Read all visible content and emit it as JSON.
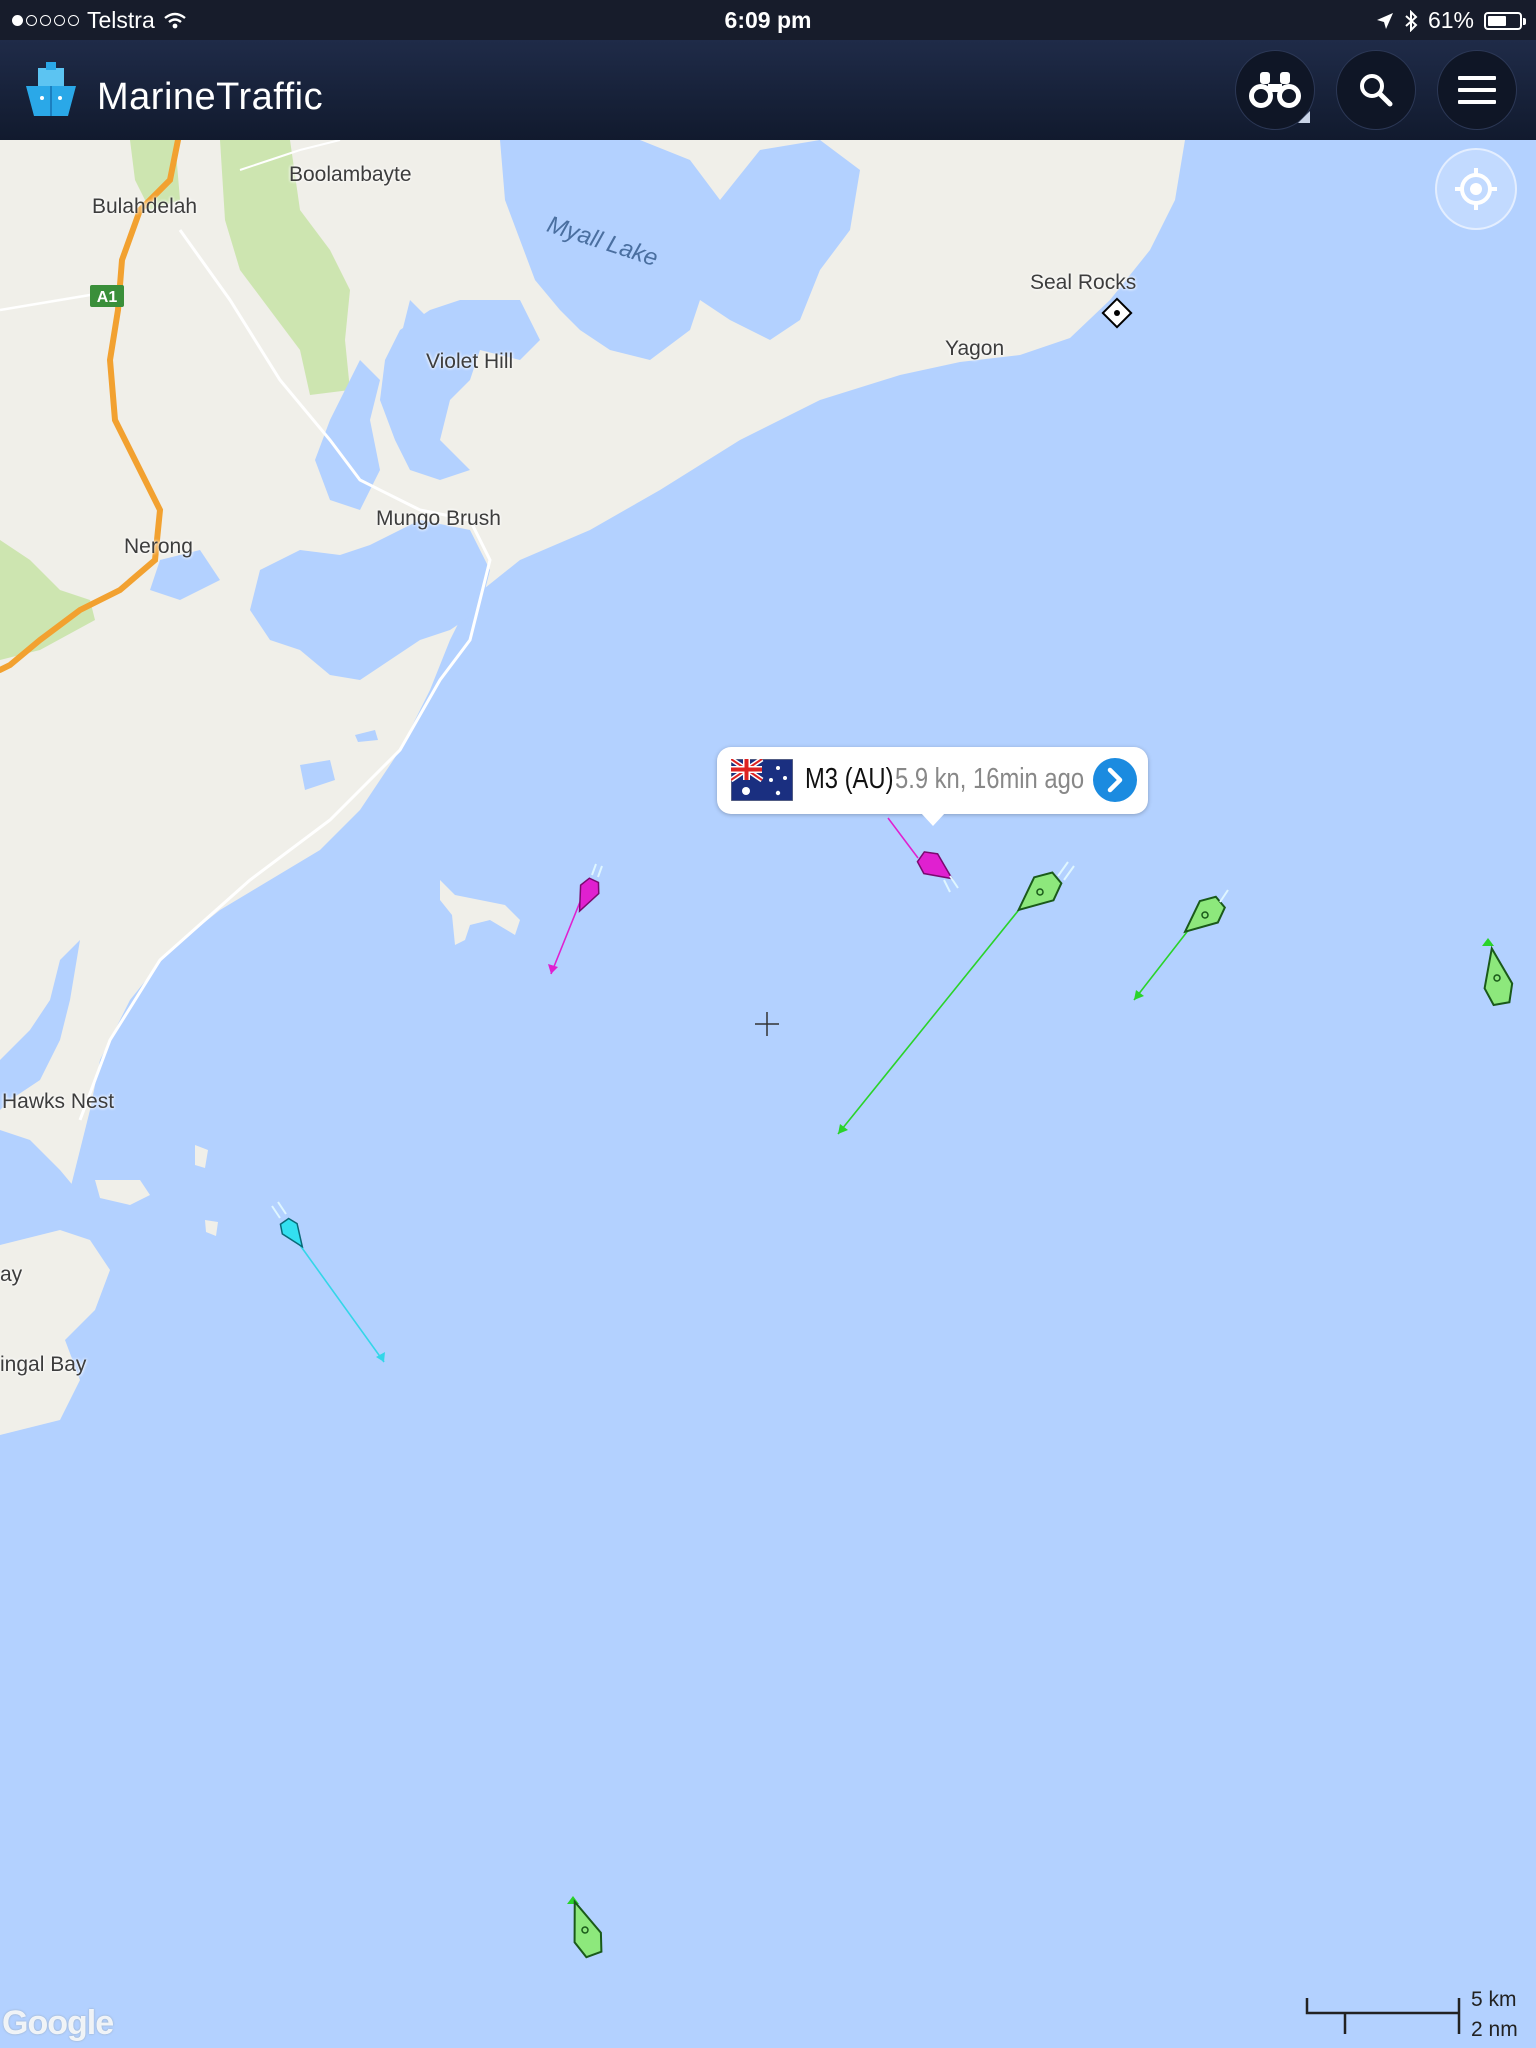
{
  "status_bar": {
    "carrier": "Telstra",
    "signal_strength": 1,
    "time": "6:09 pm",
    "battery": "61%",
    "icons": [
      "wifi-icon",
      "location-arrow-icon",
      "bluetooth-icon",
      "battery-icon"
    ]
  },
  "header": {
    "app_name": "MarineTraffic",
    "buttons": [
      {
        "name": "binoculars-button",
        "icon": "binoculars-icon"
      },
      {
        "name": "search-button",
        "icon": "search-icon"
      },
      {
        "name": "menu-button",
        "icon": "hamburger-menu-icon"
      }
    ]
  },
  "map": {
    "places": {
      "boolambayte": "Boolambayte",
      "bulahdelah": "Bulahdelah",
      "road_a1": "A1",
      "myall_lake": "Myall Lake",
      "seal_rocks": "Seal Rocks",
      "yagon": "Yagon",
      "violet_hill": "Violet Hill",
      "mungo_brush": "Mungo Brush",
      "nerong": "Nerong",
      "hawks_nest": "Hawks Nest",
      "bay_partial": "ay",
      "fingal_bay": "ingal Bay"
    },
    "colors": {
      "water": "#b3d1ff",
      "land": "#f0efe9",
      "forest": "#cde5b0",
      "highway": "#f2a130",
      "vessel_pink": "#e020d0",
      "vessel_green": "#8de87c",
      "vessel_cyan": "#33e0f0"
    },
    "attribution": "Google",
    "scale": {
      "km": "5 km",
      "nm": "2 nm"
    }
  },
  "vessel_popup": {
    "name": "M3 (AU)",
    "info": "5.9 kn, 16min ago",
    "flag": "australia-flag-icon"
  }
}
